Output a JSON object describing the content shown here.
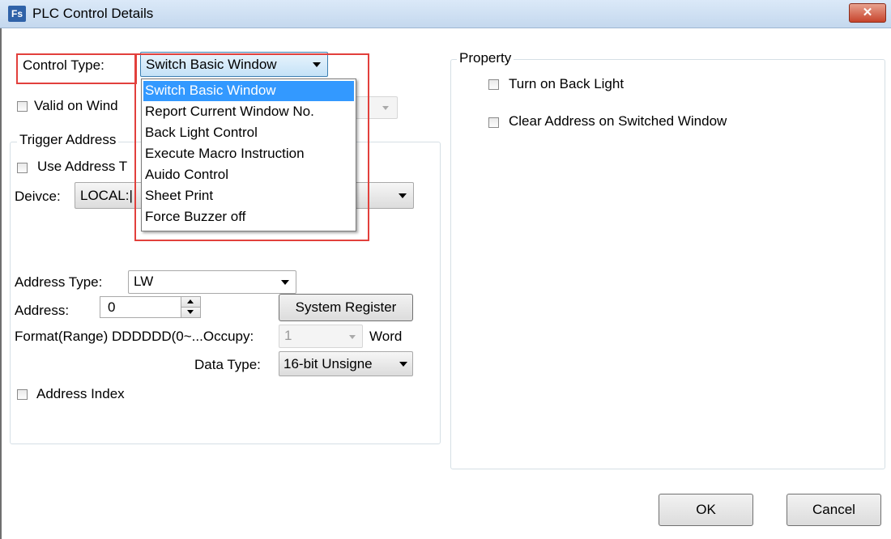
{
  "window": {
    "title": "PLC Control Details",
    "icon_text": "Fs",
    "close_symbol": "✕"
  },
  "control_type": {
    "label": "Control Type:",
    "selected": "Switch Basic Window",
    "options": [
      "Switch Basic Window",
      "Report Current Window No.",
      "Back Light Control",
      "Execute Macro Instruction",
      "Auido Control",
      "Sheet Print",
      "Force Buzzer off"
    ]
  },
  "valid_on_window": {
    "label": "Valid on Wind"
  },
  "trigger_address": {
    "group_label": "Trigger Address",
    "use_address_label": "Use Address T",
    "device_label": "Deivce:",
    "device_value": "LOCAL:|",
    "address_type_label": "Address Type:",
    "address_type_value": "LW",
    "address_label": "Address:",
    "address_value": "0",
    "system_register_label": "System Register",
    "format_label": "Format(Range) DDDDDD(0~...Occupy:",
    "occupy_value": "1",
    "word_label": "Word",
    "data_type_label": "Data Type:",
    "data_type_value": "16-bit Unsigne",
    "address_index_label": "Address Index"
  },
  "property": {
    "group_label": "Property",
    "turn_on_back_light": "Turn on Back Light",
    "clear_address": "Clear Address on Switched Window"
  },
  "buttons": {
    "ok": "OK",
    "cancel": "Cancel"
  },
  "colors": {
    "highlight": "#3399ff",
    "annotation": "#e2403c"
  }
}
